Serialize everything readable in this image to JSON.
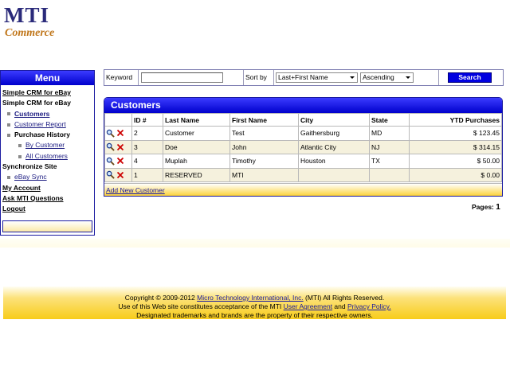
{
  "logo": {
    "title": "MTI",
    "subtitle": "Commerce"
  },
  "menu": {
    "title": "Menu",
    "items": [
      {
        "label": "Simple CRM for eBay"
      },
      {
        "label": "Simple CRM for eBay"
      },
      {
        "label": "Customers"
      },
      {
        "label": "Customer Report"
      },
      {
        "label": "Purchase History"
      },
      {
        "label": "By Customer"
      },
      {
        "label": "All Customers"
      },
      {
        "label": "Synchronize Site"
      },
      {
        "label": "eBay Sync"
      },
      {
        "label": "My Account"
      },
      {
        "label": "Ask MTI Questions"
      },
      {
        "label": "Logout"
      }
    ]
  },
  "search": {
    "keyword_label": "Keyword",
    "keyword_value": "",
    "sort_label": "Sort by",
    "sort_field": "Last+First Name",
    "sort_order": "Ascending",
    "button": "Search"
  },
  "customers": {
    "title": "Customers",
    "columns": [
      "",
      "ID #",
      "Last Name",
      "First Name",
      "City",
      "State",
      "YTD Purchases"
    ],
    "rows": [
      {
        "id": "2",
        "last": "Customer",
        "first": "Test",
        "city": "Gaithersburg",
        "state": "MD",
        "ytd": "$ 123.45"
      },
      {
        "id": "3",
        "last": "Doe",
        "first": "John",
        "city": "Atlantic City",
        "state": "NJ",
        "ytd": "$ 314.15"
      },
      {
        "id": "4",
        "last": "Muplah",
        "first": "Timothy",
        "city": "Houston",
        "state": "TX",
        "ytd": "$ 50.00"
      },
      {
        "id": "1",
        "last": "RESERVED",
        "first": "MTI",
        "city": "",
        "state": "",
        "ytd": "$ 0.00"
      }
    ],
    "add_link": "Add New Customer",
    "pages_label": "Pages:",
    "pages_value": "1"
  },
  "footer": {
    "line1_pre": "Copyright © 2009-2012 ",
    "line1_link": "Micro Technology International, Inc.",
    "line1_post": " (MTI) All Rights Reserved.",
    "line2_pre": "Use of this Web site constitutes acceptance of the MTI ",
    "line2_link1": "User Agreement",
    "line2_mid": " and ",
    "line2_link2": "Privacy Policy.",
    "line3": "Designated trademarks and brands are the property of their respective owners."
  },
  "colors": {
    "menu_header": "#0000cc",
    "search_button": "#0000e0",
    "footer_gold": "#f8cc1a",
    "link": "#1a1aa0",
    "delete_x": "#cc0000"
  },
  "icons": {
    "view": "magnifier-icon",
    "delete": "delete-x-icon",
    "select_arrow": "chevron-down-icon"
  }
}
